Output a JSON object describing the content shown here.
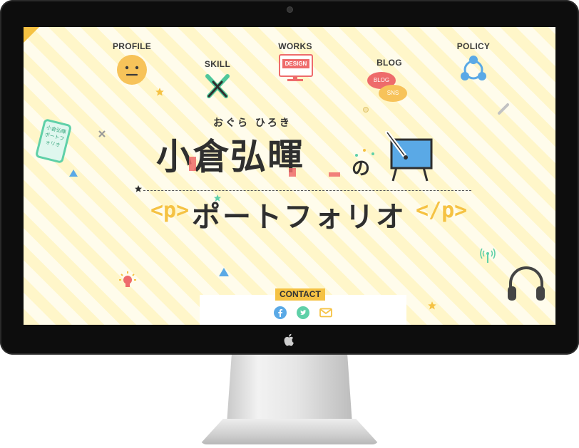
{
  "nav": {
    "profile": "PROFILE",
    "skill": "SKILL",
    "works": "WORKS",
    "works_badge": "DESIGN",
    "blog": "BLOG",
    "blog_bubble1": "BLOG",
    "blog_bubble2": "SNS",
    "policy": "POLICY"
  },
  "hero": {
    "reading": "おぐら ひろき",
    "name": "小倉弘暉",
    "particle": "の",
    "tag_open": "<p>",
    "subtitle": "ポートフォリオ",
    "tag_close": "</p>"
  },
  "phone_text": "小倉弘暉ポートフォリオ",
  "contact": {
    "label": "CONTACT",
    "icons": [
      "facebook-icon",
      "twitter-icon",
      "mail-icon"
    ]
  },
  "colors": {
    "accent_yellow": "#f5c243",
    "accent_red": "#ee6b6b",
    "accent_blue": "#5aa9e6",
    "accent_green": "#5fd0a8"
  }
}
